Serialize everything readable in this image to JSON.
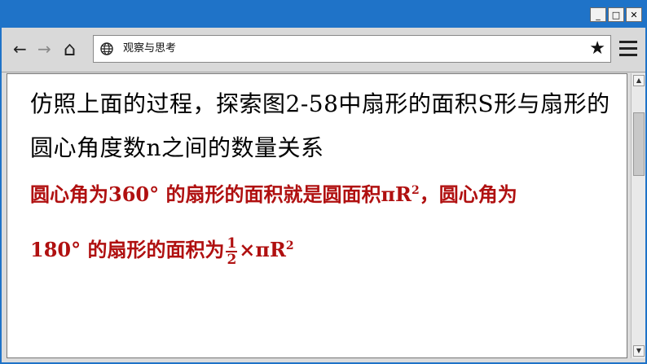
{
  "window": {
    "controls": {
      "minimize": "_",
      "maximize": "□",
      "close": "✕"
    }
  },
  "toolbar": {
    "back_icon": "back-arrow-icon",
    "forward_icon": "forward-arrow-icon",
    "home_icon": "home-icon",
    "back_glyph": "←",
    "forward_glyph": "→",
    "home_glyph": "⌂"
  },
  "address_bar": {
    "url_text": "观察与思考",
    "globe_icon": "globe-icon",
    "bookmark_icon": "star-icon",
    "bookmark_glyph": "★"
  },
  "content": {
    "line1": "仿照上面的过程，探索图2-58中扇形的面积S形与扇形的",
    "line2": "圆心角度数n之间的数量关系",
    "answer_line1_text": "圆心角为360° 的扇形的面积就是圆面积πR",
    "answer_line1_sup": "2",
    "answer_line1_tail": "，圆心角为",
    "answer_line2_text": "180° 的扇形的面积为",
    "answer_frac_num": "1",
    "answer_frac_den": "2",
    "answer_line2_tail": "×πR",
    "answer_line2_sup": "2"
  },
  "colors": {
    "titlebar": "#1f73c8",
    "answer_text": "#b01010",
    "body_text": "#000000"
  }
}
